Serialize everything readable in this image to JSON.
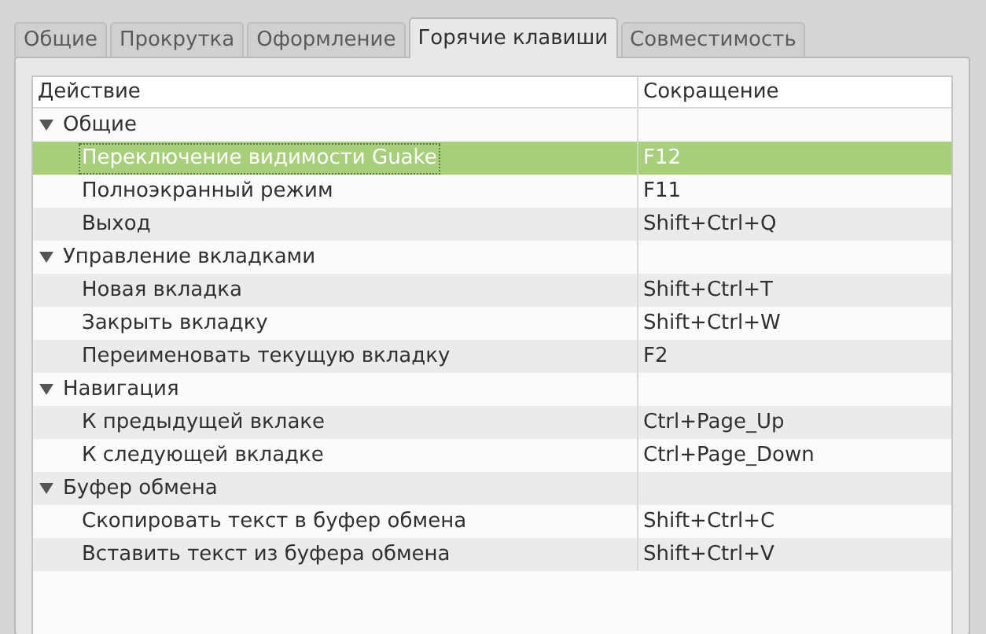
{
  "tabs": [
    {
      "label": "Общие",
      "selected": false
    },
    {
      "label": "Прокрутка",
      "selected": false
    },
    {
      "label": "Оформление",
      "selected": false
    },
    {
      "label": "Горячие клавиши",
      "selected": true
    },
    {
      "label": "Совместимость",
      "selected": false
    }
  ],
  "table": {
    "columns": [
      "Действие",
      "Сокращение"
    ],
    "groups": [
      {
        "label": "Общие",
        "expanded": true,
        "children": [
          {
            "action": "Переключение видимости Guake",
            "shortcut": "F12",
            "selected": true
          },
          {
            "action": "Полноэкранный режим",
            "shortcut": "F11",
            "selected": false
          },
          {
            "action": "Выход",
            "shortcut": "Shift+Ctrl+Q",
            "selected": false
          }
        ]
      },
      {
        "label": "Управление вкладками",
        "expanded": true,
        "children": [
          {
            "action": "Новая вкладка",
            "shortcut": "Shift+Ctrl+T",
            "selected": false
          },
          {
            "action": "Закрыть вкладку",
            "shortcut": "Shift+Ctrl+W",
            "selected": false
          },
          {
            "action": "Переименовать текущую вкладку",
            "shortcut": "F2",
            "selected": false
          }
        ]
      },
      {
        "label": "Навигация",
        "expanded": true,
        "children": [
          {
            "action": "К предыдущей вклаке",
            "shortcut": "Ctrl+Page_Up",
            "selected": false
          },
          {
            "action": "К следующей вкладке",
            "shortcut": "Ctrl+Page_Down",
            "selected": false
          }
        ]
      },
      {
        "label": "Буфер обмена",
        "expanded": true,
        "children": [
          {
            "action": "Скопировать текст в буфер обмена",
            "shortcut": "Shift+Ctrl+C",
            "selected": false
          },
          {
            "action": "Вставить текст из буфера обмена",
            "shortcut": "Shift+Ctrl+V",
            "selected": false
          }
        ]
      }
    ]
  }
}
